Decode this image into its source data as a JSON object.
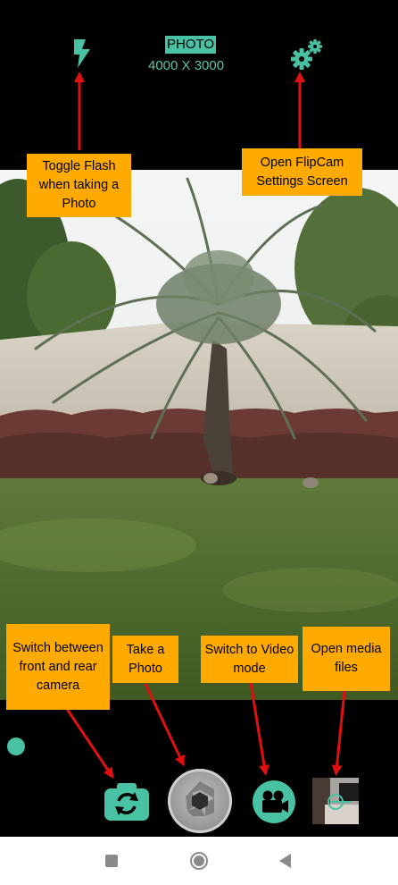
{
  "top_bar": {
    "mode": "PHOTO",
    "resolution": "4000 X 3000",
    "flash_icon": "flash-icon",
    "settings_icon": "gears-icon"
  },
  "bottom_bar": {
    "switch_camera_icon": "camera-switch-icon",
    "shutter_icon": "shutter-aperture-icon",
    "video_icon": "video-camera-icon",
    "media_icon": "media-thumbnail"
  },
  "annotations": {
    "flash": "Toggle Flash when taking a Photo",
    "settings": "Open FlipCam Settings Screen",
    "switch_camera": "Switch between front and rear camera",
    "take_photo": "Take a Photo",
    "video_mode": "Switch to Video mode",
    "media": "Open media files"
  },
  "colors": {
    "accent": "#48c2a3",
    "callout": "#ffaa00",
    "arrow": "#e01010"
  }
}
